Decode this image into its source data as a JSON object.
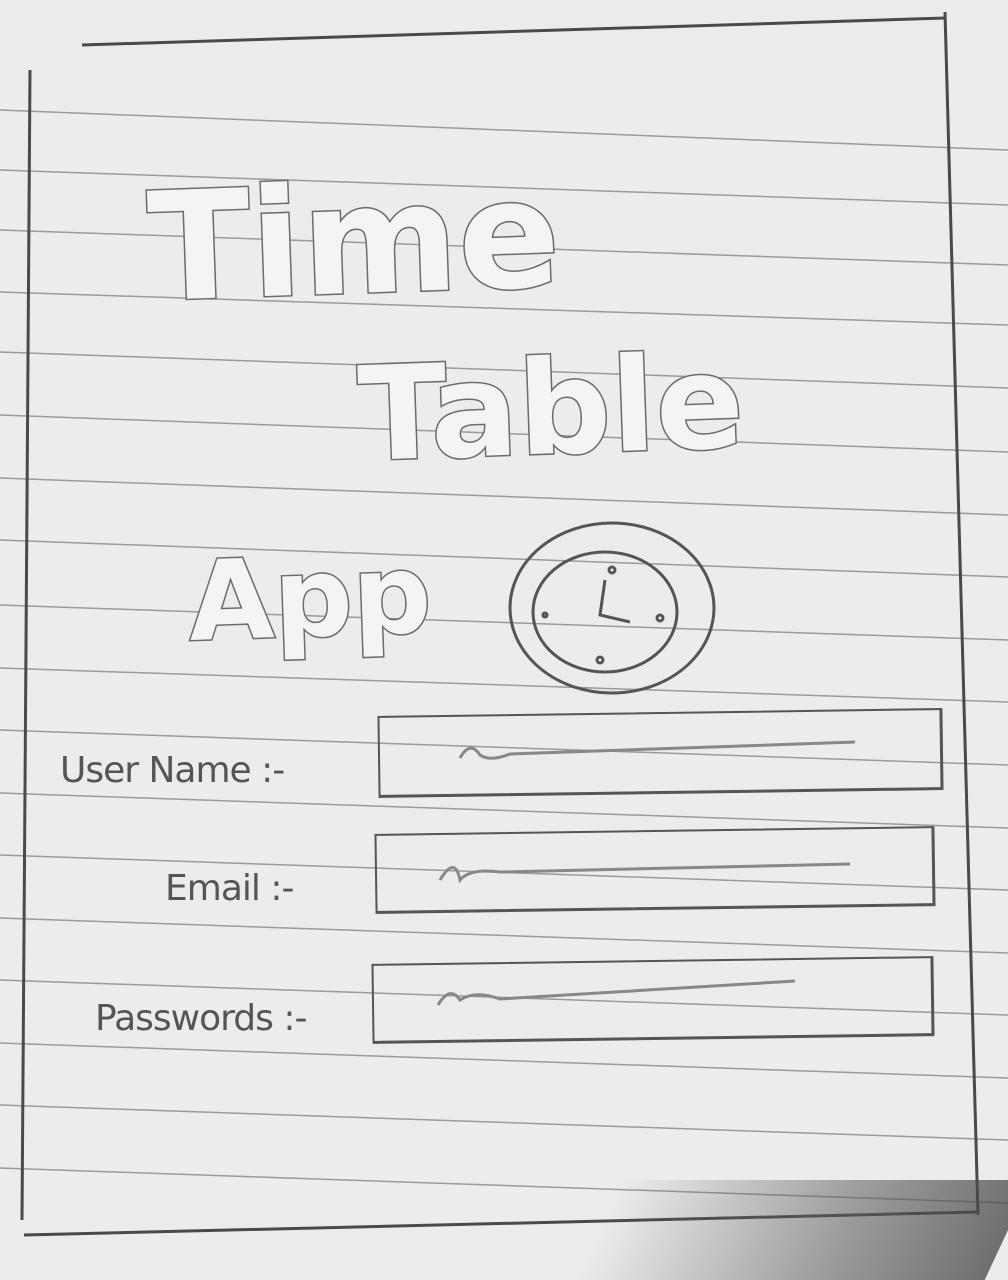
{
  "title": {
    "line1": "Time",
    "line2": "Table",
    "line3": "App"
  },
  "logo": {
    "icon": "clock-icon"
  },
  "form": {
    "fields": [
      {
        "label": "User Name :-",
        "value": ""
      },
      {
        "label": "Email :-",
        "value": ""
      },
      {
        "label": "Passwords :-",
        "value": ""
      }
    ]
  }
}
